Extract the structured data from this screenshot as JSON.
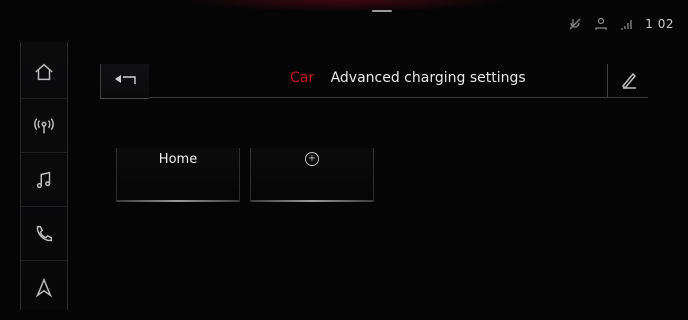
{
  "status": {
    "time": "1 02",
    "icons": [
      "no-mic-icon",
      "profile-icon",
      "lte-signal-icon"
    ]
  },
  "sidebar": {
    "items": [
      {
        "name": "home",
        "icon": "home-icon"
      },
      {
        "name": "radio",
        "icon": "radio-icon"
      },
      {
        "name": "music",
        "icon": "music-note-icon"
      },
      {
        "name": "phone",
        "icon": "phone-icon"
      },
      {
        "name": "navigation",
        "icon": "navigation-arrow-icon"
      }
    ]
  },
  "header": {
    "brand": "Car",
    "title": "Advanced charging settings",
    "back_icon": "back-icon",
    "edit_icon": "edit-pencil-icon"
  },
  "tiles": [
    {
      "label": "Home"
    },
    {
      "label": "",
      "icon": "add-circle-icon",
      "icon_text": "+"
    }
  ],
  "colors": {
    "accent": "#c8141c",
    "background": "#050506",
    "text": "#e9e9e9"
  }
}
